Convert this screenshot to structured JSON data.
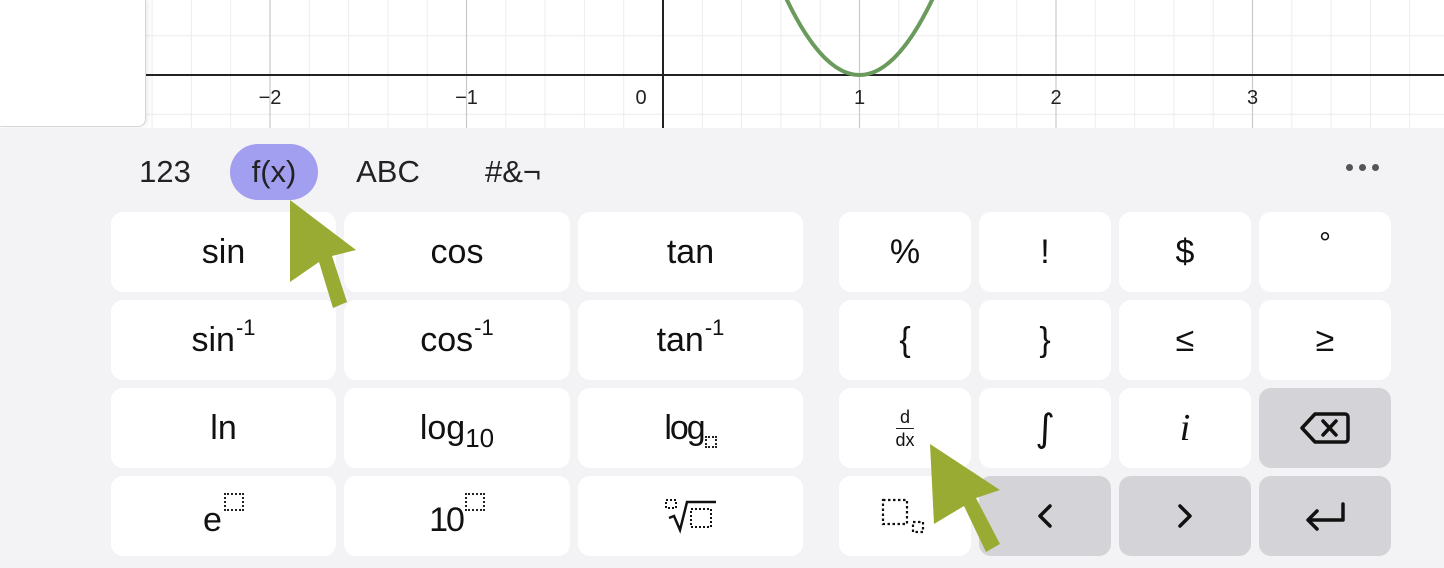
{
  "graph": {
    "x_ticks": [
      "−2",
      "−1",
      "0",
      "1",
      "2",
      "3"
    ],
    "curve_color": "#6a9a5c",
    "grid_on": true
  },
  "keypad": {
    "tabs": [
      {
        "label": "123",
        "active": false
      },
      {
        "label": "f(x)",
        "active": true
      },
      {
        "label": "ABC",
        "active": false
      },
      {
        "label": "#&¬",
        "active": false
      }
    ],
    "more_icon": "ellipsis-icon",
    "functions": {
      "sin": "sin",
      "cos": "cos",
      "tan": "tan",
      "arcsin_base": "sin",
      "arccos_base": "cos",
      "arctan_base": "tan",
      "inverse_sup": "-1",
      "ln": "ln",
      "log10_base": "log",
      "log10_sub": "10",
      "logn_base": "log",
      "exp_base": "e",
      "pow10_base": "10"
    },
    "symbols": {
      "percent": "%",
      "factorial": "!",
      "dollar": "$",
      "degree": "°",
      "lbrace": "{",
      "rbrace": "}",
      "le": "≤",
      "ge": "≥",
      "deriv_num": "d",
      "deriv_den": "dx",
      "integral": "∫",
      "imaginary": "i"
    },
    "nav_icons": {
      "backspace": "backspace-icon",
      "left": "arrow-left-icon",
      "right": "arrow-right-icon",
      "enter": "enter-icon"
    },
    "accent_color": "#a29ef0",
    "arrow_color": "#9aab34"
  }
}
